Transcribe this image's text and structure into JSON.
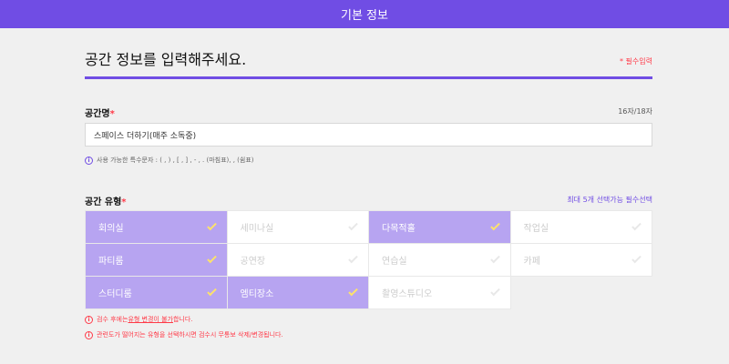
{
  "topbar": {
    "title": "기본 정보"
  },
  "header": {
    "heading": "공간 정보를 입력해주세요.",
    "required_note": "* 필수입력"
  },
  "space_name": {
    "label": "공간명",
    "star": "*",
    "counter": "16자/18자",
    "value": "스페이스 더하기(매주 소독중)",
    "hint": "사용 가능한 특수문자 : ( , ) , [ , ] , - , . (마침표), , (쉼표)"
  },
  "space_type": {
    "label": "공간 유형",
    "star": "*",
    "limit_note": "최대 5개 선택가능 필수선택",
    "options": [
      {
        "label": "회의실",
        "selected": true
      },
      {
        "label": "세미나실",
        "selected": false
      },
      {
        "label": "다목적홀",
        "selected": true
      },
      {
        "label": "작업실",
        "selected": false
      },
      {
        "label": "파티룸",
        "selected": true
      },
      {
        "label": "공연장",
        "selected": false
      },
      {
        "label": "연습실",
        "selected": false
      },
      {
        "label": "카페",
        "selected": false
      },
      {
        "label": "스터디룸",
        "selected": true
      },
      {
        "label": "엠티장소",
        "selected": true
      },
      {
        "label": "촬영스튜디오",
        "selected": false
      }
    ],
    "note1_prefix": "검수 후에는 ",
    "note1_link": "유형 변경이 불가",
    "note1_suffix": "합니다.",
    "note2": "관련도가 떨어지는 유형을 선택하시면 검수시 무통보 삭제/변경됩니다."
  },
  "icons": {
    "info": "i",
    "check": "check-icon"
  },
  "colors": {
    "accent": "#704de4",
    "selected": "#b7a4f1",
    "check": "#fde26a",
    "alert": "#ff3a48"
  }
}
